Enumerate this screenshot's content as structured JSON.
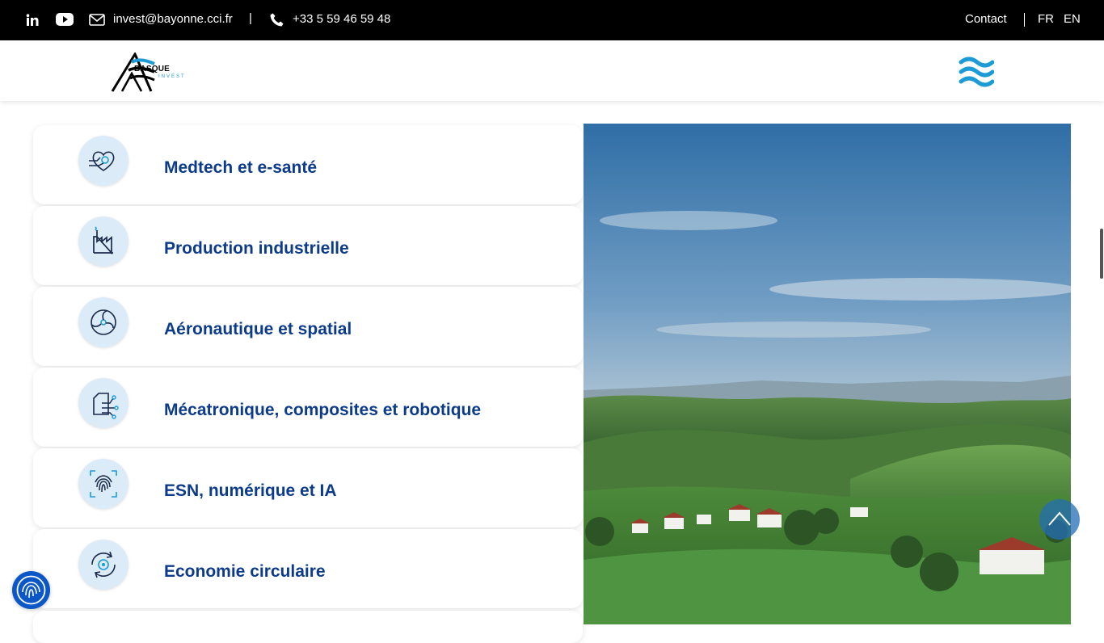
{
  "topbar": {
    "email": "invest@bayonne.cci.fr",
    "separator": "|",
    "phone": "+33 5 59 46 59 48",
    "contact_label": "Contact",
    "lang_fr": "FR",
    "lang_en": "EN",
    "icons": [
      "linkedin-icon",
      "youtube-icon",
      "mail-icon",
      "phone-icon"
    ]
  },
  "header": {
    "logo_text": "BASQUE",
    "logo_sub": "INVEST",
    "menu_icon": "menu-waves-icon"
  },
  "sectors": [
    {
      "label": "Medtech et e-santé",
      "icon": "heart-hand-icon"
    },
    {
      "label": "Production industrielle",
      "icon": "factory-icon"
    },
    {
      "label": "Aéronautique et spatial",
      "icon": "turbine-icon"
    },
    {
      "label": "Mécatronique, composites et robotique",
      "icon": "circuit-icon"
    },
    {
      "label": "ESN, numérique et IA",
      "icon": "fingerprint-icon"
    },
    {
      "label": "Economie circulaire",
      "icon": "recycle-target-icon"
    }
  ],
  "colors": {
    "topbar_bg": "#000000",
    "sector_text": "#0d3b8c",
    "icon_circle": "#dcebf8",
    "accent": "#1d9bd7",
    "access_button": "#0b57c7"
  },
  "floating": {
    "scroll_top_icon": "chevron-up-icon",
    "accessibility_icon": "fingerprint-accessibility-icon"
  }
}
